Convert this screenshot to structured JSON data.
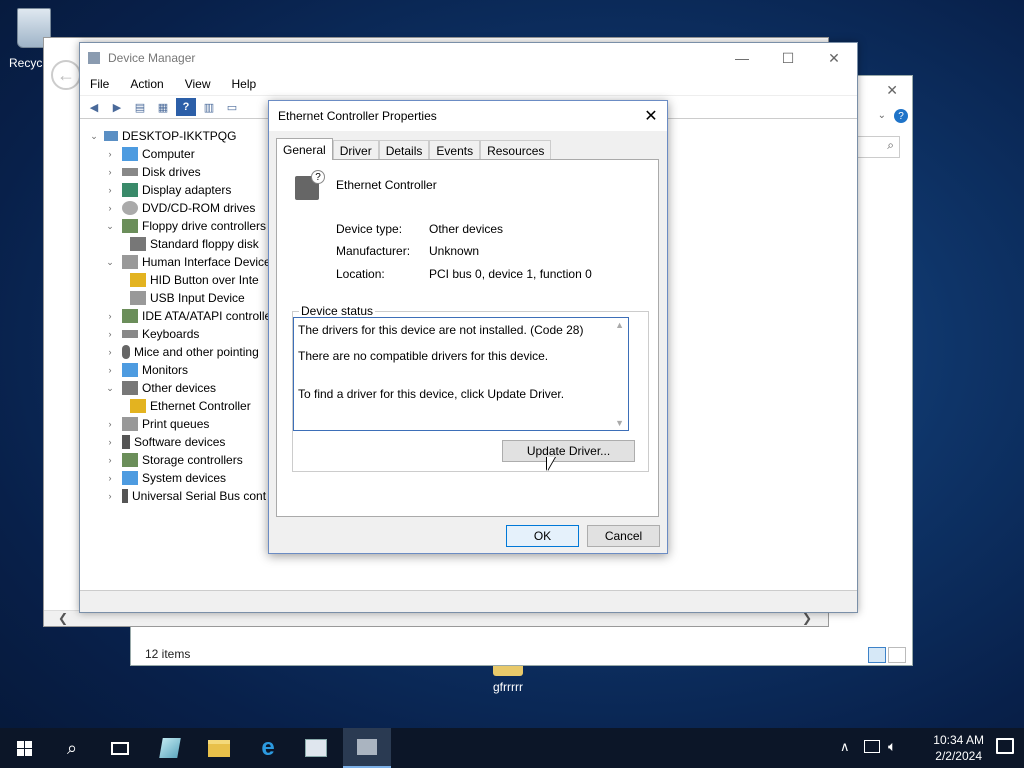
{
  "desktop": {
    "recycle_label": "Recycl",
    "folder_label": "gfrrrrr"
  },
  "explorer": {
    "status": "12 items"
  },
  "device_manager": {
    "title": "Device Manager",
    "menu": [
      "File",
      "Action",
      "View",
      "Help"
    ],
    "tree": {
      "root": "DESKTOP-IKKTPQG",
      "items": [
        {
          "label": "Computer"
        },
        {
          "label": "Disk drives"
        },
        {
          "label": "Display adapters"
        },
        {
          "label": "DVD/CD-ROM drives"
        },
        {
          "label": "Floppy drive controllers"
        },
        {
          "label": "Standard floppy disk"
        },
        {
          "label": "Human Interface Device"
        },
        {
          "label": "HID Button over Inte"
        },
        {
          "label": "USB Input Device"
        },
        {
          "label": "IDE ATA/ATAPI controlle"
        },
        {
          "label": "Keyboards"
        },
        {
          "label": "Mice and other pointing"
        },
        {
          "label": "Monitors"
        },
        {
          "label": "Other devices"
        },
        {
          "label": "Ethernet Controller"
        },
        {
          "label": "Print queues"
        },
        {
          "label": "Software devices"
        },
        {
          "label": "Storage controllers"
        },
        {
          "label": "System devices"
        },
        {
          "label": "Universal Serial Bus cont"
        }
      ]
    }
  },
  "dialog": {
    "title": "Ethernet Controller Properties",
    "tabs": [
      "General",
      "Driver",
      "Details",
      "Events",
      "Resources"
    ],
    "device_name": "Ethernet Controller",
    "device_type_label": "Device type:",
    "device_type": "Other devices",
    "manufacturer_label": "Manufacturer:",
    "manufacturer": "Unknown",
    "location_label": "Location:",
    "location": "PCI bus 0, device 1, function 0",
    "status_legend": "Device status",
    "status_line1": "The drivers for this device are not installed. (Code 28)",
    "status_line2": "There are no compatible drivers for this device.",
    "status_line3": "To find a driver for this device, click Update Driver.",
    "update_button": "Update Driver...",
    "ok": "OK",
    "cancel": "Cancel"
  },
  "taskbar": {
    "time": "10:34 AM",
    "date": "2/2/2024"
  }
}
